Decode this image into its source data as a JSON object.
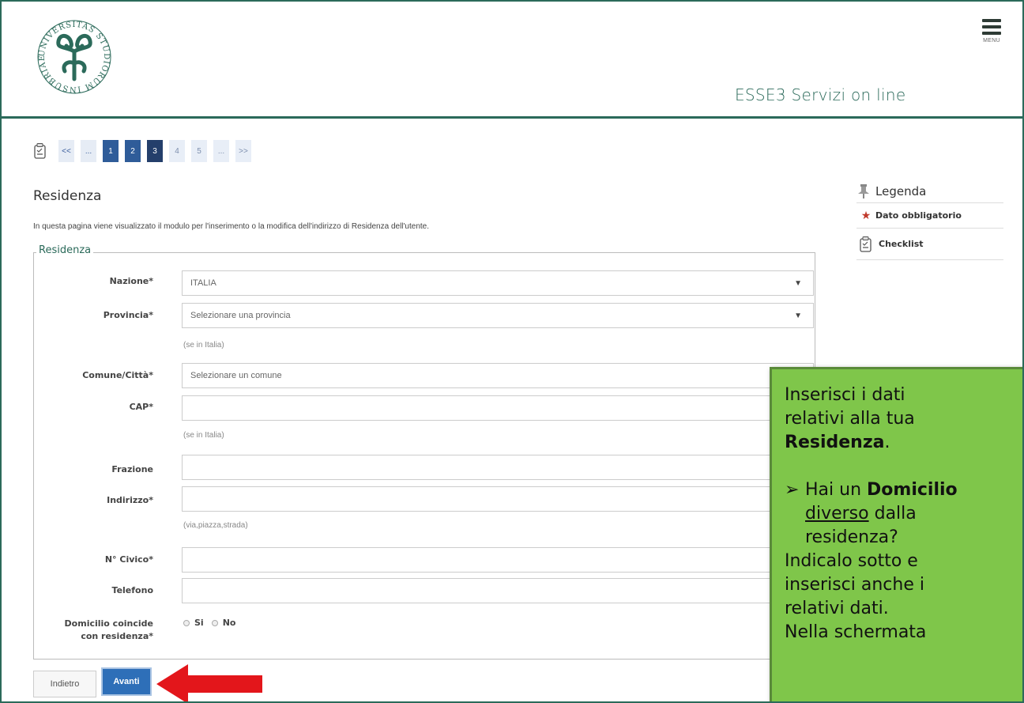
{
  "header": {
    "app_title": "ESSE3 Servizi on line",
    "menu_label": "MENU",
    "logo_text": "UNIVERSITAS STUDIORUM INSUBRIAE"
  },
  "pager": {
    "items": [
      "<<",
      "...",
      "1",
      "2",
      "3",
      "4",
      "5",
      "...",
      ">>"
    ],
    "current": "3"
  },
  "page": {
    "title": "Residenza",
    "intro": "In questa pagina viene visualizzato il modulo per l'inserimento o la modifica dell'indirizzo di Residenza dell'utente."
  },
  "form": {
    "legend": "Residenza",
    "nazione_label": "Nazione*",
    "nazione_value": "ITALIA",
    "provincia_label": "Provincia*",
    "provincia_value": "Selezionare una provincia",
    "provincia_hint": "(se in Italia)",
    "comune_label": "Comune/Città*",
    "comune_value": "Selezionare un comune",
    "cap_label": "CAP*",
    "cap_hint": "(se in Italia)",
    "frazione_label": "Frazione",
    "indirizzo_label": "Indirizzo*",
    "indirizzo_hint": "(via,piazza,strada)",
    "civico_label": "N° Civico*",
    "telefono_label": "Telefono",
    "domicilio_label_1": "Domicilio coincide",
    "domicilio_label_2": "con residenza*",
    "radio_si": "Si",
    "radio_no": "No",
    "select_arrow": "▼"
  },
  "buttons": {
    "back": "Indietro",
    "next": "Avanti"
  },
  "legenda": {
    "title": "Legenda",
    "items": [
      {
        "icon": "star-icon",
        "label": "Dato obbligatorio"
      },
      {
        "icon": "checklist-icon",
        "label": "Checklist"
      }
    ]
  },
  "callout": {
    "line1": "Inserisci i dati",
    "line2": "relativi alla tua",
    "line3": "Residenza",
    "line3_suffix": ".",
    "bullet_prefix": "Hai un ",
    "bullet_bold": "Domicilio",
    "bullet_underline": "diverso",
    "bullet_rest1": " dalla",
    "bullet_rest2": "residenza?",
    "line4": "Indicalo sotto e",
    "line5": "inserisci anche i",
    "line6": "relativi dati.",
    "line7": "Nella schermata"
  },
  "colors": {
    "brand_green": "#2b6a5a",
    "page_done": "#2f5c99",
    "page_current": "#243f6b",
    "button_primary": "#2e6fb8",
    "callout_bg": "#7fc64a",
    "arrow_red": "#e3161b"
  }
}
